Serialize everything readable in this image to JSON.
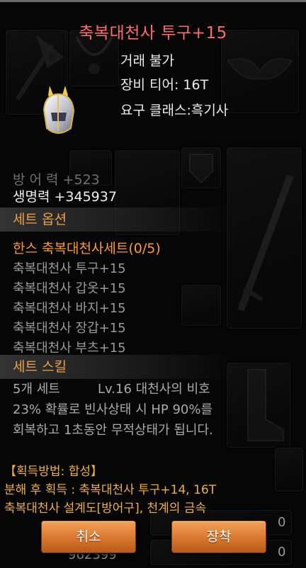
{
  "item": {
    "title": "축복대천사 투구+15",
    "trade": "거래 불가",
    "tier": "장비 티어:  16T",
    "class": "요구 클래스:흑기사"
  },
  "stats": {
    "faded": "방 어 력 +523",
    "hp": "생명력 +345937"
  },
  "set": {
    "header": "세트 옵션",
    "name": "한스 축복대천사세트(0/5)",
    "items": [
      "축복대천사 투구+15",
      "축복대천사 갑옷+15",
      "축복대천사 바지+15",
      "축복대천사 장갑+15",
      "축복대천사 부츠+15"
    ]
  },
  "skill": {
    "header": "세트 스킬",
    "count": "5개 세트",
    "name": "Lv.16 대천사의 비호",
    "desc1": "23% 확률로 빈사상태 시 HP 90%를",
    "desc2": "회복하고 1초동안 무적상태가 됩니다."
  },
  "acquire": {
    "title": "【획득방법: 합성】",
    "line1": " 분해 후 획득 : 축복대천사 투구+14, 16T",
    "line2": "축복대천사 설계도[방어구], 천계의 금속"
  },
  "buttons": {
    "cancel": "취소",
    "equip": "장착"
  },
  "background": {
    "gold": "962399",
    "count_a": "0",
    "count_b": "0",
    "count_c": "0"
  },
  "colors": {
    "title": "#ff6b6b",
    "set_name": "#ff9a2e",
    "acquire": "#f0b040",
    "button": "#d9772f"
  }
}
